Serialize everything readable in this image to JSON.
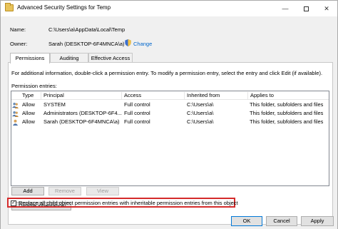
{
  "window": {
    "title": "Advanced Security Settings for Temp",
    "minimize_glyph": "—",
    "close_glyph": "✕"
  },
  "name": {
    "label": "Name:",
    "value": "C:\\Users\\a\\AppData\\Local\\Temp"
  },
  "owner": {
    "label": "Owner:",
    "value": "Sarah (DESKTOP-6F4MNCA\\a)",
    "change_link": "Change"
  },
  "tabs": [
    {
      "label": "Permissions",
      "active": true
    },
    {
      "label": "Auditing",
      "active": false
    },
    {
      "label": "Effective Access",
      "active": false
    }
  ],
  "info_text": "For additional information, double-click a permission entry. To modify a permission entry, select the entry and click Edit (if available).",
  "entries_label": "Permission entries:",
  "columns": [
    "Type",
    "Principal",
    "Access",
    "Inherited from",
    "Applies to"
  ],
  "entries": [
    {
      "type": "Allow",
      "principal": "SYSTEM",
      "access": "Full control",
      "inherited": "C:\\Users\\a\\",
      "applies": "This folder, subfolders and files",
      "icon": "group-icon"
    },
    {
      "type": "Allow",
      "principal": "Administrators (DESKTOP-6F4...",
      "access": "Full control",
      "inherited": "C:\\Users\\a\\",
      "applies": "This folder, subfolders and files",
      "icon": "group-icon"
    },
    {
      "type": "Allow",
      "principal": "Sarah (DESKTOP-6F4MNCA\\a)",
      "access": "Full control",
      "inherited": "C:\\Users\\a\\",
      "applies": "This folder, subfolders and files",
      "icon": "user-icon"
    }
  ],
  "buttons": {
    "add": "Add",
    "remove": "Remove",
    "view": "View",
    "disable_inheritance": "Disable inheritance"
  },
  "replace_checkbox": {
    "checked": true,
    "label": "Replace all child object permission entries with inheritable permission entries from this object"
  },
  "footer": {
    "ok": "OK",
    "cancel": "Cancel",
    "apply": "Apply"
  }
}
